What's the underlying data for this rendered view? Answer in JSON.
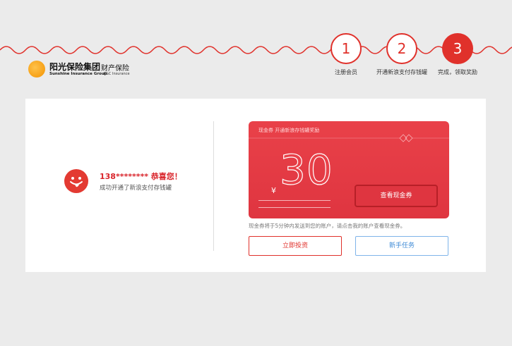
{
  "brand": {
    "name_cn": "阳光保险集团",
    "division_cn": "财产保险",
    "name_en": "Sunshine Insurance Group",
    "division_en": "P&C Insurance"
  },
  "steps": [
    {
      "number": "1",
      "label": "注册会员",
      "state": "todo"
    },
    {
      "number": "2",
      "label": "开通新浪支付存钱罐",
      "state": "todo"
    },
    {
      "number": "3",
      "label": "完成，领取奖励",
      "state": "current"
    }
  ],
  "success": {
    "headline": "138******** 恭喜您！",
    "subtext": "成功开通了新浪支付存钱罐"
  },
  "coupon": {
    "title": "现金券   开通新浪存钱罐奖励",
    "currency": "¥",
    "amount": "30",
    "view_button": "查看现金券"
  },
  "note": "现金券将于5分钟内发送到您的账户，请点击我的账户查看现金券。",
  "actions": {
    "invest": "立即投资",
    "tasks": "新手任务"
  },
  "colors": {
    "accent": "#e0312b",
    "coupon_bg": "#e94149",
    "link_blue": "#3d8ad6"
  }
}
